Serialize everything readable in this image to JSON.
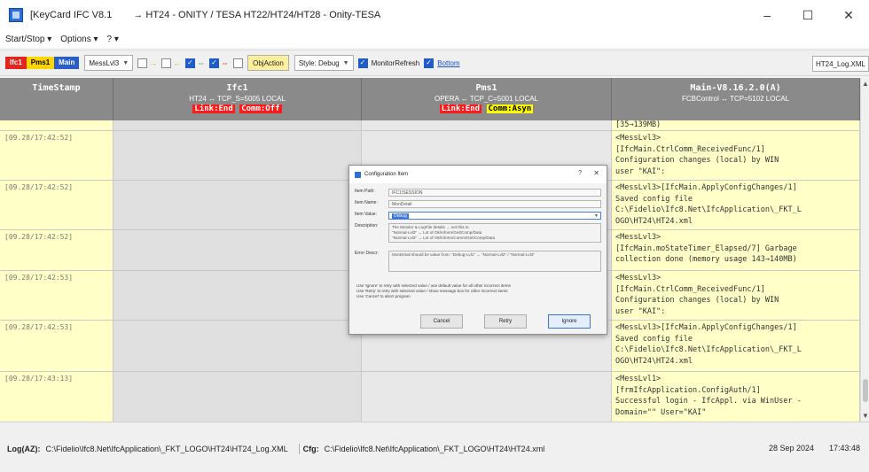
{
  "window": {
    "app_title": "[KeyCard IFC V8.1",
    "doc_title": "→ HT24 - ONITY / TESA HT22/HT24/HT28 - Onity-TESA",
    "minimize_glyph": "–",
    "maximize_glyph": "☐",
    "close_glyph": "✕"
  },
  "menu": {
    "items": [
      "Start/Stop ▾",
      "Options ▾",
      "? ▾"
    ]
  },
  "toolbar": {
    "tag_ifc": "Ifc1",
    "tag_pms": "Pms1",
    "tag_main": "Main",
    "mess_select": "MessLvl3",
    "arrow_right": "→",
    "arrow_left": "←",
    "arrow_both": "⇔",
    "arrow_both_red": "⇔",
    "obj_action": "ObjAction",
    "style_select": "Style: Debug",
    "monitor_refresh": "MonitorRefresh",
    "bottom_link": "Bottom",
    "log_file": "HT24_Log.XML"
  },
  "columns": {
    "timestamp": {
      "title": "TimeStamp"
    },
    "ifc": {
      "title": "Ifc1",
      "sub": "HT24 ↔ TCP_S=5005 LOCAL",
      "tag1": "Link:End",
      "tag2": "Comm:Off"
    },
    "pms": {
      "title": "Pms1",
      "sub": "OPERA ↔ TCP_C=5001 LOCAL",
      "tag1": "Link:End",
      "tag2": "Comm:Asyn"
    },
    "main": {
      "title": "Main-V8.16.2.0(A)",
      "sub": "FCBControl ↔ TCP=5102 LOCAL"
    }
  },
  "rows": [
    {
      "ts": "",
      "main": "[35→139MB)"
    },
    {
      "ts": "[09.28/17:42:52]",
      "main": "<MessLvl3>\n[IfcMain.CtrlComm_ReceivedFunc/1]\nConfiguration changes (local) by WIN\nuser \"KAI\":"
    },
    {
      "ts": "[09.28/17:42:52]",
      "main": "<MessLvl3>[IfcMain.ApplyConfigChanges/1]\nSaved config file\nC:\\Fidelio\\Ifc8.Net\\IfcApplication\\_FKT_L\nOGO\\HT24\\HT24.xml"
    },
    {
      "ts": "[09.28/17:42:52]",
      "main": "<MessLvl3>\n[IfcMain.moStateTimer_Elapsed/7] Garbage\ncollection done (memory usage 143→140MB)"
    },
    {
      "ts": "[09.28/17:42:53]",
      "main": "<MessLvl3>\n[IfcMain.CtrlComm_ReceivedFunc/1]\nConfiguration changes (local) by WIN\nuser \"KAI\":"
    },
    {
      "ts": "[09.28/17:42:53]",
      "main": "<MessLvl3>[IfcMain.ApplyConfigChanges/1]\nSaved config file\nC:\\Fidelio\\Ifc8.Net\\IfcApplication\\_FKT_L\nOGO\\HT24\\HT24.xml"
    },
    {
      "ts": "[09.28/17:43:13]",
      "main": "<MessLvl1>\n[frmIfcApplication.ConfigAuth/1]\nSuccessful login - IfcAppl. via WinUser -\nDomain=\"\" User=\"KAI\""
    }
  ],
  "dialog": {
    "title": "Configuration Item",
    "help": "?",
    "close": "✕",
    "item_path_label": "Item Path:",
    "item_path_value": "IFC1\\SESSION",
    "item_name_label": "Item Name:",
    "item_name_value": "MonDetail",
    "item_value_label": "Item Value:",
    "item_value_value": "Debug",
    "description_label": "Description:",
    "description_value": "The Monitor & LogFile details → set this to\n\"Normal-Lvl3\" → Lot of Ok/Inform/Get/Comp/Data\n\"Normal-Lvl2\" → Lot of Ok/Inform/Comm/Get/Comp/Data",
    "error_label": "Error Descr:",
    "error_value": "MonDetail should be value from: \"Debug-Lvl1\" → \"Normal-Lvl2\" / \"Normal-Lvl3\"",
    "help_text": "Use 'Ignore' to retry with selected value / use default value for all other incorrect items\nUse 'Retry' to retry with selected value / show message box for other incorrect items\nUse 'Cancel' to abort program",
    "btn_cancel": "Cancel",
    "btn_retry": "Retry",
    "btn_ignore": "Ignore"
  },
  "status": {
    "log_key": "Log(AZ):",
    "log_path": "C:\\Fidelio\\Ifc8.Net\\IfcApplication\\_FKT_LOGO\\HT24\\HT24_Log.XML",
    "cfg_key": "Cfg:",
    "cfg_path": "C:\\Fidelio\\Ifc8.Net\\IfcApplication\\_FKT_LOGO\\HT24\\HT24.xml",
    "date": "28 Sep 2024",
    "time": "17:43:48"
  }
}
